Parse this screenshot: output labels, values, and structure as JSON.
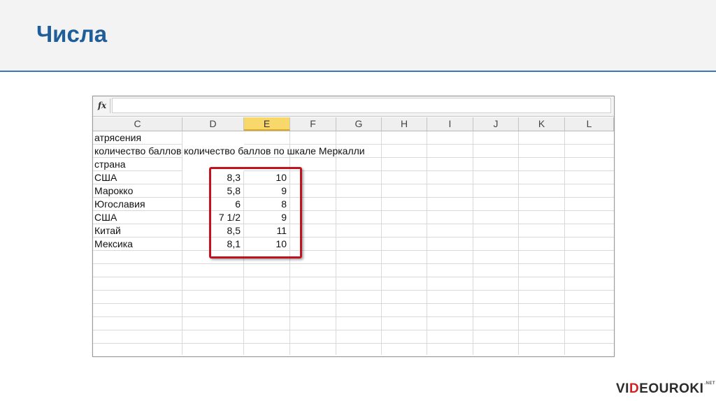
{
  "slide": {
    "title": "Числа"
  },
  "formula_bar": {
    "fx_label": "fx",
    "value": ""
  },
  "columns": [
    "C",
    "D",
    "E",
    "F",
    "G",
    "H",
    "I",
    "J",
    "K",
    "L"
  ],
  "active_column": "E",
  "rows": [
    {
      "c": "атрясения",
      "d": "",
      "e": ""
    },
    {
      "c": "количество баллов г",
      "d": "количество баллов по шкале Меркалли",
      "e": ""
    },
    {
      "c": "страна",
      "d": "",
      "e": ""
    },
    {
      "c": "США",
      "d": "8,3",
      "e": "10"
    },
    {
      "c": "Марокко",
      "d": "5,8",
      "e": "9"
    },
    {
      "c": "Югославия",
      "d": "6",
      "e": "8"
    },
    {
      "c": "США",
      "d": "7 1/2",
      "e": "9"
    },
    {
      "c": "Китай",
      "d": "8,5",
      "e": "11"
    },
    {
      "c": "Мексика",
      "d": "8,1",
      "e": "10"
    }
  ],
  "highlight_color": "#c1121f",
  "logo": {
    "prefix": "VI",
    "accent": "D",
    "suffix": "EOUROKI",
    "tld": ".NET"
  }
}
